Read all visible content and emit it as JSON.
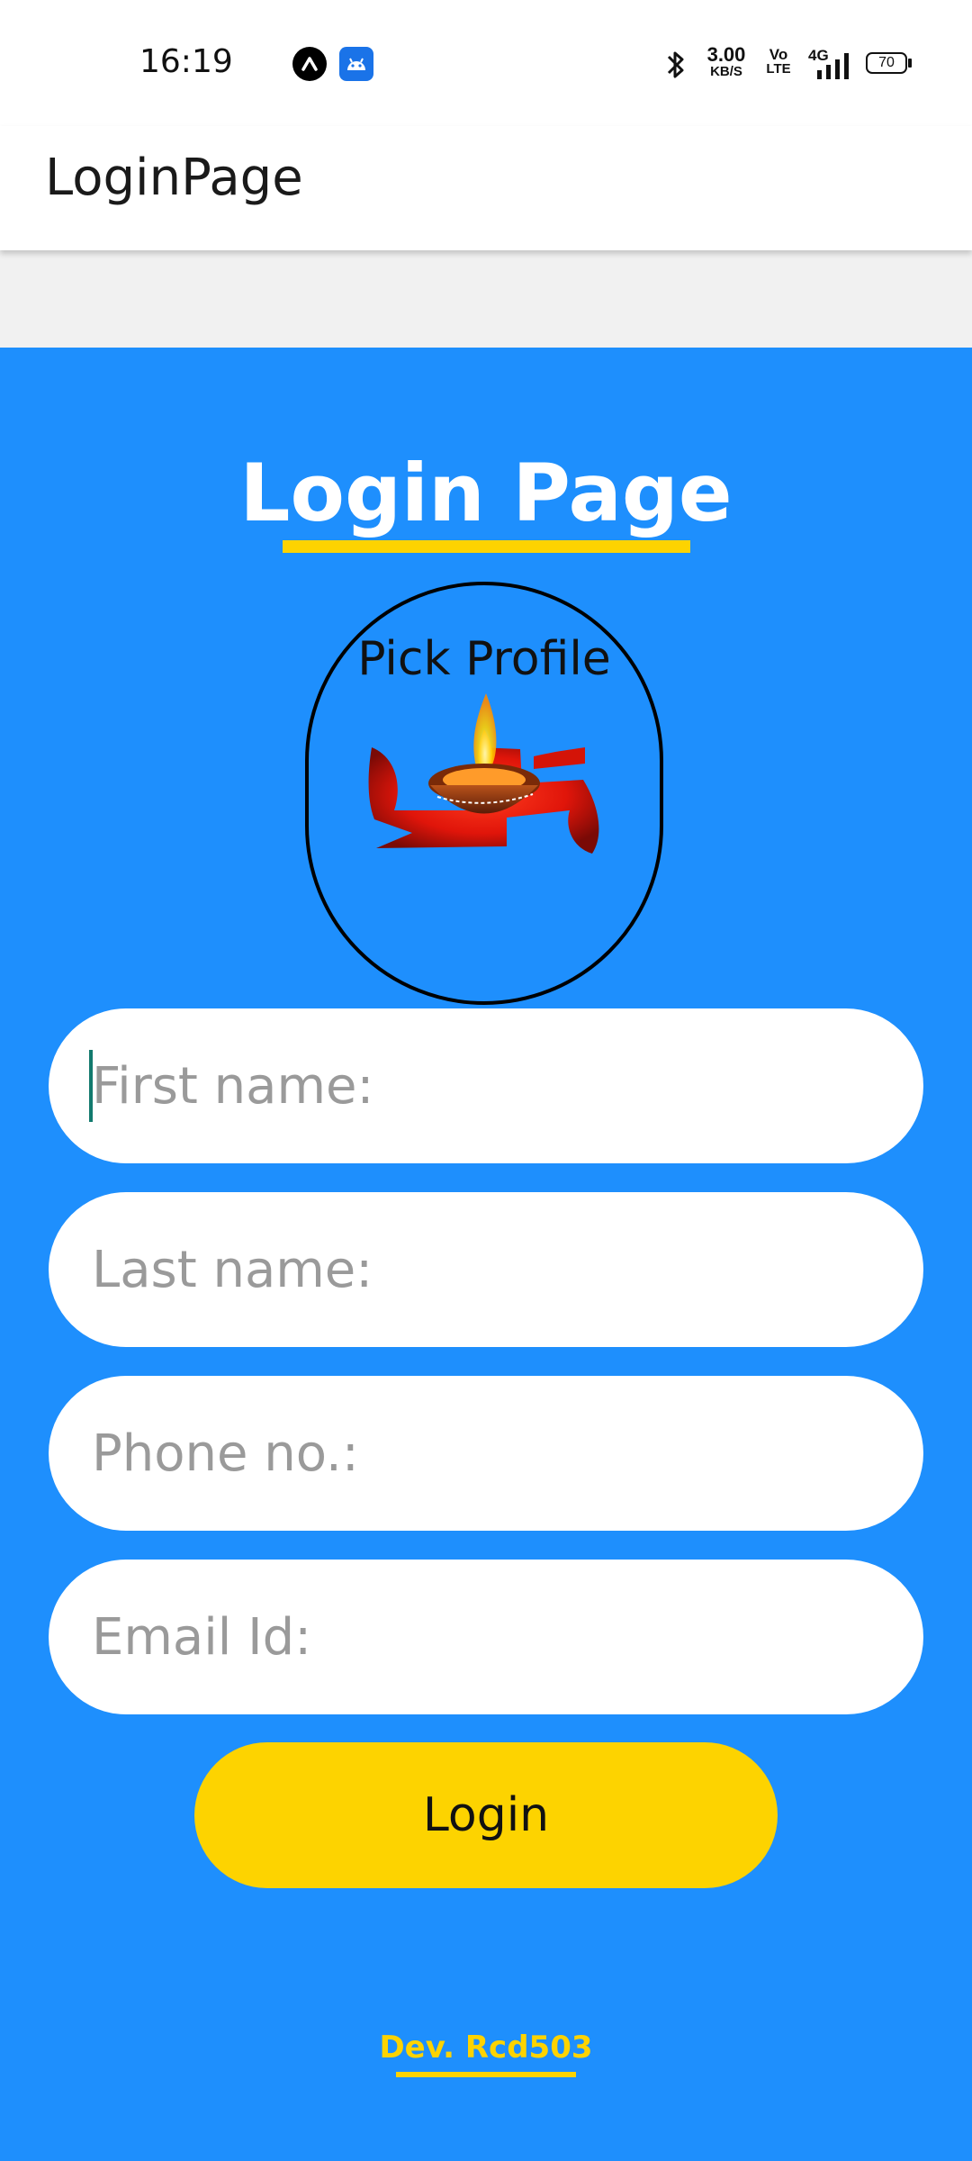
{
  "status_bar": {
    "time": "16:19",
    "app_icons": [
      "app-a-icon",
      "android-icon"
    ],
    "network_speed_value": "3.00",
    "network_speed_unit": "KB/S",
    "volte_top": "Vo",
    "volte_bottom": "LTE",
    "network_type": "4G",
    "battery": "70",
    "icons": [
      "bluetooth-icon",
      "signal-icon",
      "battery-icon"
    ]
  },
  "app_bar": {
    "title": "LoginPage"
  },
  "page": {
    "title": "Login Page",
    "profile": {
      "label": "Pick Profile"
    },
    "fields": {
      "first_name_placeholder": "First name:",
      "last_name_placeholder": "Last name:",
      "phone_placeholder": "Phone no.:",
      "email_placeholder": "Email Id:"
    },
    "login_label": "Login",
    "dev_credit": "Dev. Rcd503"
  },
  "colors": {
    "panel_blue": "#1e8ffd",
    "accent_yellow": "#fdd300",
    "field_white": "#ffffff",
    "caret_teal": "#127a6e"
  }
}
